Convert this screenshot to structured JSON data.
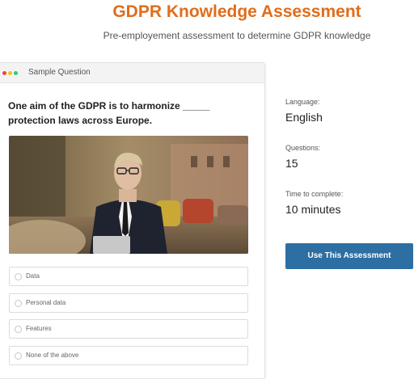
{
  "header": {
    "title": "GDPR Knowledge Assessment",
    "subtitle": "Pre-employement assessment to determine GDPR knowledge"
  },
  "sample": {
    "header_label": "Sample Question",
    "question": "One aim of the GDPR is to harmonize _____  protection laws across Europe.",
    "options": [
      "Data",
      "Personal data",
      "Features",
      "None of the above"
    ]
  },
  "details": {
    "language_label": "Language:",
    "language_value": "English",
    "questions_label": "Questions:",
    "questions_value": "15",
    "time_label": "Time to complete:",
    "time_value": "10 minutes"
  },
  "cta": {
    "label": "Use This Assessment",
    "color": "#2d6ea3"
  },
  "colors": {
    "title": "#e06d1c"
  }
}
